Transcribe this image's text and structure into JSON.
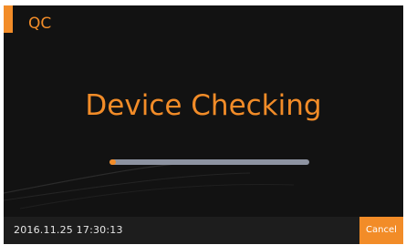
{
  "header": {
    "title": "QC"
  },
  "main": {
    "message": "Device Checking",
    "progress": {
      "value_percent": 3
    }
  },
  "footer": {
    "timestamp": "2016.11.25  17:30:13",
    "cancel_label": "Cancel"
  },
  "colors": {
    "accent": "#f28c28",
    "background": "#121212",
    "footer": "#1d1d1d",
    "track": "#8d93a1"
  }
}
